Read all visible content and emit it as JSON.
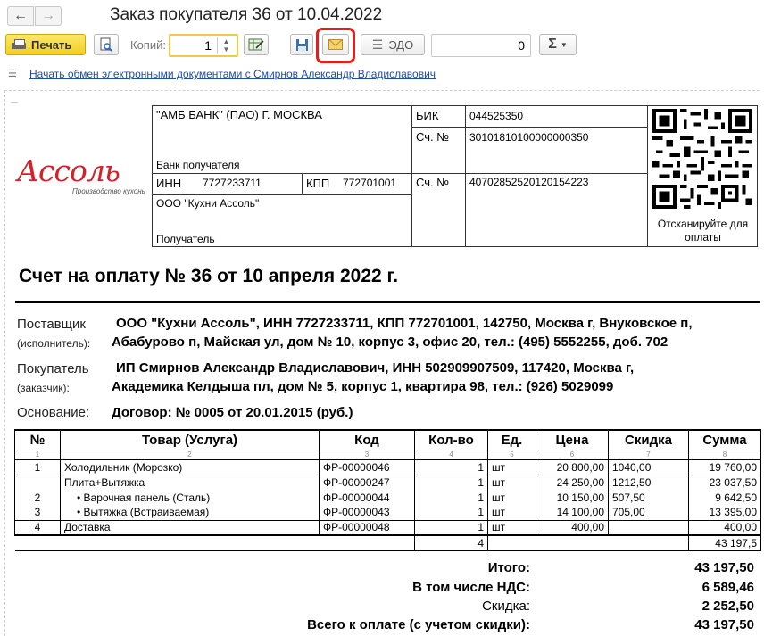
{
  "window": {
    "title": "Заказ покупателя 36 от 10.04.2022",
    "back_icon": "arrow-left-icon",
    "forward_icon": "arrow-right-icon"
  },
  "toolbar": {
    "print_label": "Печать",
    "copies_label": "Копий:",
    "copies_value": "1",
    "edo_label": "ЭДО",
    "sum_value": "0",
    "sigma_label": "Σ"
  },
  "edo_link": "Начать обмен электронными документами с Смирнов Александр Владиславович",
  "logo": {
    "name": "Ассоль",
    "tagline": "Производство кухонь"
  },
  "bank": {
    "bank_name": "\"АМБ БАНК\" (ПАО) Г. МОСКВА",
    "bank_label": "Банк получателя",
    "bik_label": "БИК",
    "bik": "044525350",
    "acc_label": "Сч. №",
    "corr_account": "30101810100000000350",
    "inn_label": "ИНН",
    "inn": "7727233711",
    "kpp_label": "КПП",
    "kpp": "772701001",
    "account": "40702852520120154223",
    "recipient": "ООО \"Кухни Ассоль\"",
    "recipient_label": "Получатель",
    "qr_caption": "Отсканируйте для оплаты"
  },
  "invoice": {
    "title": "Счет на оплату № 36 от 10 апреля 2022 г.",
    "supplier_label": "Поставщик",
    "supplier_sub": "(исполнитель):",
    "supplier_line1": "ООО \"Кухни Ассоль\",  ИНН 7727233711,  КПП 772701001,  142750, Москва г, Внуковское п,",
    "supplier_line2": "Абабурово п, Майская ул, дом № 10, корпус 3, офис 20,  тел.: (495) 5552255, доб. 702",
    "buyer_label": "Покупатель",
    "buyer_sub": "(заказчик):",
    "buyer_line1": "ИП Смирнов Александр Владиславович,  ИНН 502909907509,  117420, Москва г,",
    "buyer_line2": "Академика Келдыша пл, дом № 5, корпус 1, квартира 98,  тел.: (926) 5029099",
    "basis_label": "Основание:",
    "basis": "Договор: № 0005 от 20.01.2015 (руб.)"
  },
  "table": {
    "headers": [
      "№",
      "Товар (Услуга)",
      "Код",
      "Кол-во",
      "Ед.",
      "Цена",
      "Скидка",
      "Сумма"
    ],
    "col_numbers": [
      "1",
      "2",
      "3",
      "4",
      "5",
      "6",
      "7",
      "8"
    ],
    "rows": [
      {
        "num": "1",
        "name": "Холодильник (Морозко)",
        "code": "ФР-00000046",
        "qty": "1",
        "unit": "шт",
        "price": "20 800,00",
        "discount": "1040,00",
        "sum": "19 760,00"
      },
      {
        "num": "",
        "name": "Плита+Вытяжка",
        "code": "ФР-00000247",
        "qty": "1",
        "unit": "шт",
        "price": "24 250,00",
        "discount": "1212,50",
        "sum": "23 037,50"
      },
      {
        "num": "2",
        "name": "• Варочная панель (Сталь)",
        "code": "ФР-00000044",
        "qty": "1",
        "unit": "шт",
        "price": "10 150,00",
        "discount": "507,50",
        "sum": "9 642,50"
      },
      {
        "num": "3",
        "name": "• Вытяжка (Встраиваемая)",
        "code": "ФР-00000043",
        "qty": "1",
        "unit": "шт",
        "price": "14 100,00",
        "discount": "705,00",
        "sum": "13 395,00"
      },
      {
        "num": "4",
        "name": "Доставка",
        "code": "ФР-00000048",
        "qty": "1",
        "unit": "шт",
        "price": "400,00",
        "discount": "",
        "sum": "400,00"
      }
    ],
    "total_qty": "4",
    "total_sum": "43 197,5"
  },
  "totals": {
    "total_label": "Итого:",
    "total_value": "43 197,50",
    "vat_label": "В том числе НДС:",
    "vat_value": "6 589,46",
    "discount_label": "Скидка:",
    "discount_value": "2 252,50",
    "grand_label": "Всего к оплате (с учетом скидки):",
    "grand_value": "43 197,50"
  }
}
